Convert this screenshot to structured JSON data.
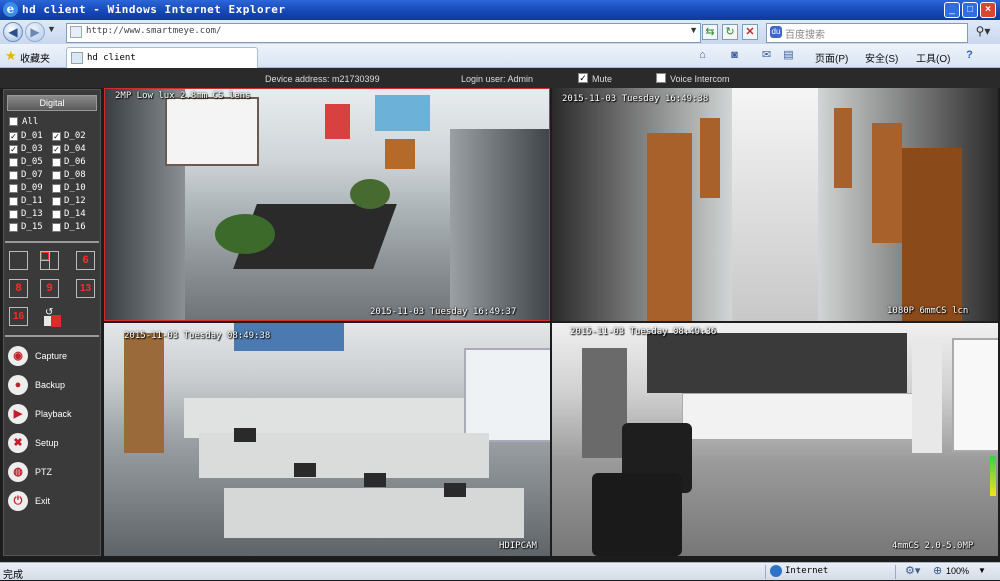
{
  "window": {
    "title": "hd client - Windows Internet Explorer",
    "minimize": "_",
    "maximize": "□",
    "close": "×"
  },
  "addressbar": {
    "url": "http://www.smartmeye.com/",
    "search_placeholder": "百度搜索",
    "search_engine_badge": "du"
  },
  "favorites": {
    "label": "收藏夹",
    "tab_title": "hd client",
    "commands": [
      "页面(P)",
      "安全(S)",
      "工具(O)"
    ]
  },
  "app": {
    "device_address": "Device address: m21730399",
    "login_user": "Login user: Admin",
    "mute_label": "Mute",
    "mute_checked": true,
    "voice_intercom_label": "Voice Intercom",
    "voice_intercom_checked": false,
    "sidebar": {
      "tab": "Digital",
      "all_label": "All",
      "channels": [
        {
          "label": "D_01",
          "checked": true
        },
        {
          "label": "D_02",
          "checked": true
        },
        {
          "label": "D_03",
          "checked": true
        },
        {
          "label": "D_04",
          "checked": true
        },
        {
          "label": "D_05",
          "checked": false
        },
        {
          "label": "D_06",
          "checked": false
        },
        {
          "label": "D_07",
          "checked": false
        },
        {
          "label": "D_08",
          "checked": false
        },
        {
          "label": "D_09",
          "checked": false
        },
        {
          "label": "D_10",
          "checked": false
        },
        {
          "label": "D_11",
          "checked": false
        },
        {
          "label": "D_12",
          "checked": false
        },
        {
          "label": "D_13",
          "checked": false
        },
        {
          "label": "D_14",
          "checked": false
        },
        {
          "label": "D_15",
          "checked": false
        },
        {
          "label": "D_16",
          "checked": false
        }
      ],
      "layouts": [
        "1",
        "4",
        "6",
        "8",
        "9",
        "13",
        "16"
      ],
      "actions": [
        {
          "label": "Capture",
          "icon": "capture-icon"
        },
        {
          "label": "Backup",
          "icon": "backup-icon"
        },
        {
          "label": "Playback",
          "icon": "playback-icon"
        },
        {
          "label": "Setup",
          "icon": "setup-icon"
        },
        {
          "label": "PTZ",
          "icon": "ptz-icon"
        },
        {
          "label": "Exit",
          "icon": "exit-icon"
        }
      ]
    },
    "cameras": [
      {
        "top_osd": "2MP  Low  lux 2.8mm CS lens",
        "bottom_osd": "2015-11-03 Tuesday 16:49:37"
      },
      {
        "top_osd": "2015-11-03 Tuesday 16:49:38",
        "bottom_osd": "1080P 6mmCS lcn"
      },
      {
        "top_osd": "2015-11-03  Tuesday  08:49:38",
        "bottom_osd": "HDIPCAM"
      },
      {
        "top_osd": "2015-11-03 Tuesday 08:49:36",
        "bottom_osd": "4mmCS 2.0-5.0MP"
      }
    ]
  },
  "statusbar": {
    "status": "完成",
    "zone": "Internet",
    "zoom": "100%"
  }
}
